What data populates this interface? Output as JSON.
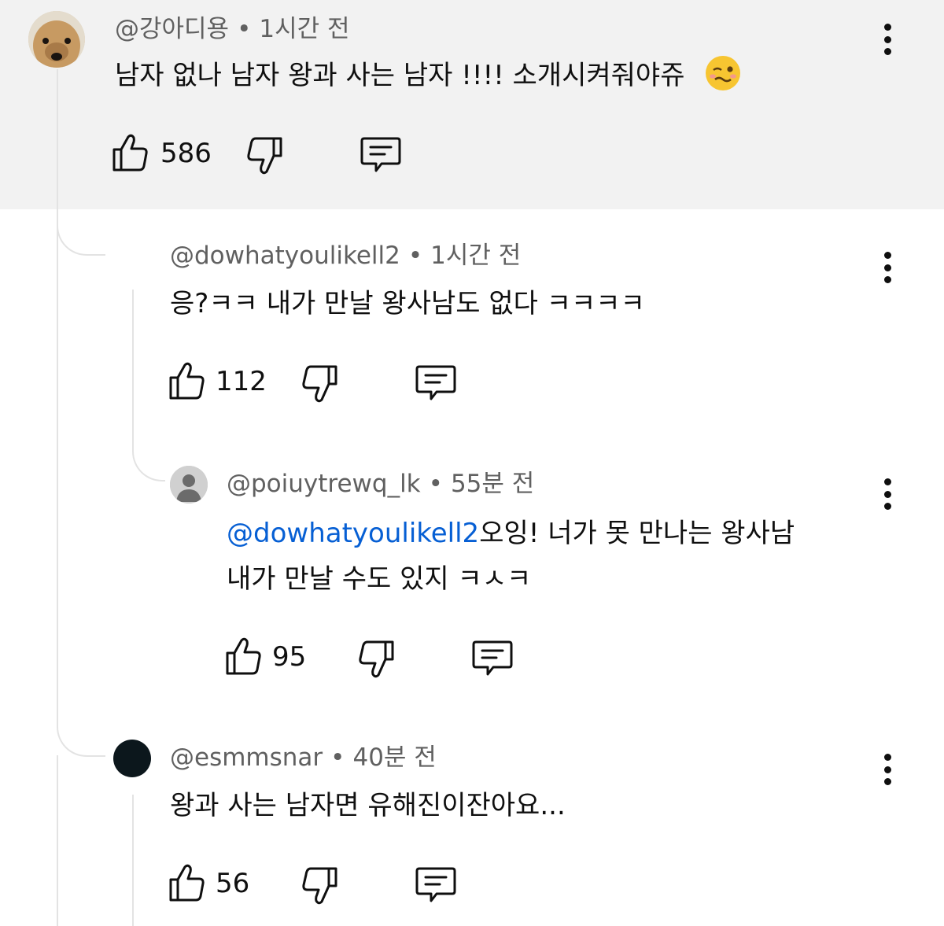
{
  "comments": [
    {
      "author": "@강아디용",
      "time": "1시간 전",
      "text": "남자 없나 남자 왕과 사는 남자 !!!! 소개시켜줘야쥬",
      "likes": "586"
    },
    {
      "author": "@dowhatyoulikell2",
      "time": "1시간 전",
      "text": "응?ㅋㅋ 내가 만날 왕사남도 없다 ㅋㅋㅋㅋ",
      "likes": "112"
    },
    {
      "author": "@poiuytrewq_lk",
      "time": "55분 전",
      "mention": "@dowhatyoulikell2",
      "text_line1": "오잉! 너가 못 만나는 왕사남",
      "text_line2": "내가 만날 수도 있지 ㅋㅅㅋ",
      "likes": "95"
    },
    {
      "author": "@esmmsnar",
      "time": "40분 전",
      "text": "왕과 사는 남자면 유해진이잔아요...",
      "likes": "56"
    }
  ],
  "separator": "•",
  "emoji": "🥴",
  "icons": {
    "like": "thumbs-up-icon",
    "dislike": "thumbs-down-icon",
    "reply": "reply-comment-icon",
    "more": "more-vertical-icon"
  }
}
